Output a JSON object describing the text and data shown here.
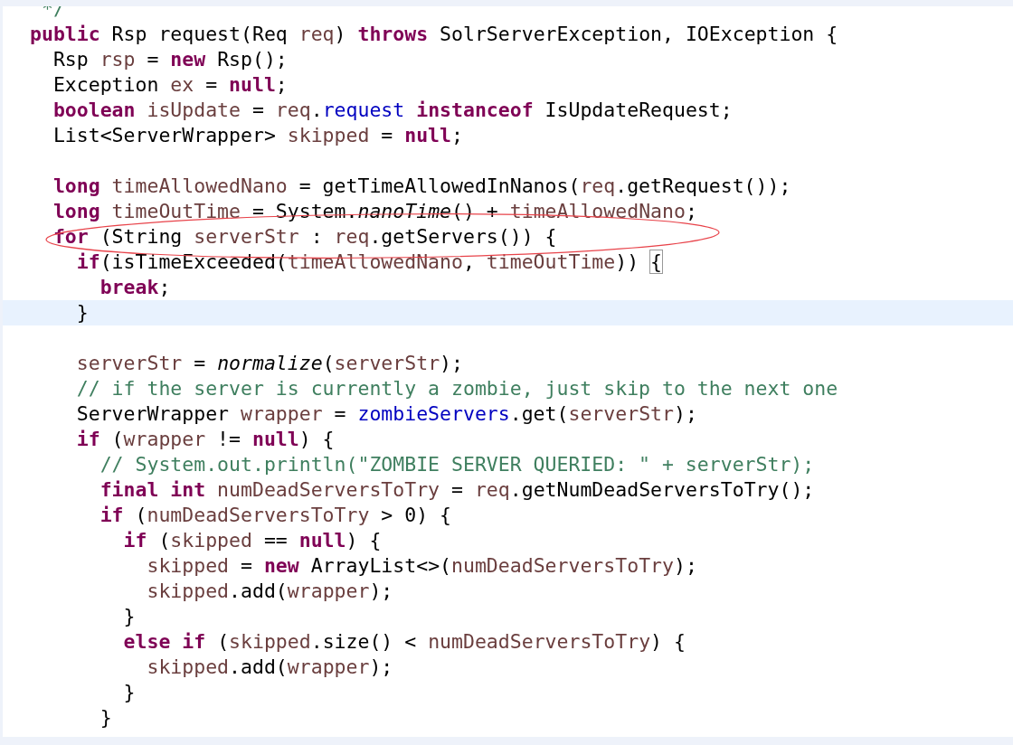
{
  "editor": {
    "lines": [
      {
        "current": false,
        "tokens": [
          {
            "t": " */",
            "kind": "comment"
          }
        ]
      },
      {
        "current": false,
        "tokens": [
          {
            "t": "public",
            "kind": "kw"
          },
          {
            "t": " Rsp request(Req ",
            "kind": "plain"
          },
          {
            "t": "req",
            "kind": "var"
          },
          {
            "t": ") ",
            "kind": "plain"
          },
          {
            "t": "throws",
            "kind": "kw"
          },
          {
            "t": " SolrServerException, IOException {",
            "kind": "plain"
          }
        ]
      },
      {
        "current": false,
        "tokens": [
          {
            "t": "  Rsp ",
            "kind": "plain"
          },
          {
            "t": "rsp",
            "kind": "var"
          },
          {
            "t": " = ",
            "kind": "plain"
          },
          {
            "t": "new",
            "kind": "kw"
          },
          {
            "t": " Rsp();",
            "kind": "plain"
          }
        ]
      },
      {
        "current": false,
        "tokens": [
          {
            "t": "  Exception ",
            "kind": "plain"
          },
          {
            "t": "ex",
            "kind": "var"
          },
          {
            "t": " = ",
            "kind": "plain"
          },
          {
            "t": "null",
            "kind": "kw"
          },
          {
            "t": ";",
            "kind": "plain"
          }
        ]
      },
      {
        "current": false,
        "tokens": [
          {
            "t": "  boolean",
            "kind": "kw"
          },
          {
            "t": " isUpdate",
            "kind": "var"
          },
          {
            "t": " = ",
            "kind": "plain"
          },
          {
            "t": "req",
            "kind": "var"
          },
          {
            "t": ".",
            "kind": "plain"
          },
          {
            "t": "request",
            "kind": "field"
          },
          {
            "t": " instanceof",
            "kind": "kw"
          },
          {
            "t": " IsUpdateRequest;",
            "kind": "plain"
          }
        ]
      },
      {
        "current": false,
        "tokens": [
          {
            "t": "  List<ServerWrapper> ",
            "kind": "plain"
          },
          {
            "t": "skipped",
            "kind": "var"
          },
          {
            "t": " = ",
            "kind": "plain"
          },
          {
            "t": "null",
            "kind": "kw"
          },
          {
            "t": ";",
            "kind": "plain"
          }
        ]
      },
      {
        "current": false
      },
      {
        "current": false,
        "tokens": [
          {
            "t": "  long",
            "kind": "kw"
          },
          {
            "t": " timeAllowedNano",
            "kind": "var"
          },
          {
            "t": " = getTimeAllowedInNanos(",
            "kind": "plain"
          },
          {
            "t": "req",
            "kind": "var"
          },
          {
            "t": ".getRequest());",
            "kind": "plain"
          }
        ]
      },
      {
        "current": false,
        "tokens": [
          {
            "t": "  long",
            "kind": "kw"
          },
          {
            "t": " timeOutTime",
            "kind": "var"
          },
          {
            "t": " = System.",
            "kind": "plain"
          },
          {
            "t": "nanoTime",
            "kind": "static"
          },
          {
            "t": "() + ",
            "kind": "plain"
          },
          {
            "t": "timeAllowedNano",
            "kind": "var"
          },
          {
            "t": ";",
            "kind": "plain"
          }
        ]
      },
      {
        "current": false,
        "tokens": [
          {
            "t": "  for",
            "kind": "kw"
          },
          {
            "t": " (String ",
            "kind": "plain"
          },
          {
            "t": "serverStr",
            "kind": "var"
          },
          {
            "t": " : ",
            "kind": "plain"
          },
          {
            "t": "req",
            "kind": "var"
          },
          {
            "t": ".getServers()) {",
            "kind": "plain"
          }
        ]
      },
      {
        "current": false,
        "tokens": [
          {
            "t": "    if",
            "kind": "kw"
          },
          {
            "t": "(isTimeExceeded(",
            "kind": "plain"
          },
          {
            "t": "timeAllowedNano",
            "kind": "var"
          },
          {
            "t": ", ",
            "kind": "plain"
          },
          {
            "t": "timeOutTime",
            "kind": "var"
          },
          {
            "t": ")) ",
            "kind": "plain"
          },
          {
            "t": "{",
            "kind": "bracket_match"
          }
        ]
      },
      {
        "current": false,
        "tokens": [
          {
            "t": "      break",
            "kind": "kw"
          },
          {
            "t": ";",
            "kind": "plain"
          }
        ]
      },
      {
        "current": true,
        "tokens": [
          {
            "t": "    }",
            "kind": "plain"
          }
        ]
      },
      {
        "current": false
      },
      {
        "current": false,
        "tokens": [
          {
            "t": "    serverStr",
            "kind": "var"
          },
          {
            "t": " = ",
            "kind": "plain"
          },
          {
            "t": "normalize",
            "kind": "static"
          },
          {
            "t": "(",
            "kind": "plain"
          },
          {
            "t": "serverStr",
            "kind": "var"
          },
          {
            "t": ");",
            "kind": "plain"
          }
        ]
      },
      {
        "current": false,
        "tokens": [
          {
            "t": "    // if the server is currently a zombie, just skip to the next one",
            "kind": "comment"
          }
        ]
      },
      {
        "current": false,
        "tokens": [
          {
            "t": "    ServerWrapper ",
            "kind": "plain"
          },
          {
            "t": "wrapper",
            "kind": "var"
          },
          {
            "t": " = ",
            "kind": "plain"
          },
          {
            "t": "zombieServers",
            "kind": "field"
          },
          {
            "t": ".get(",
            "kind": "plain"
          },
          {
            "t": "serverStr",
            "kind": "var"
          },
          {
            "t": ");",
            "kind": "plain"
          }
        ]
      },
      {
        "current": false,
        "tokens": [
          {
            "t": "    if",
            "kind": "kw"
          },
          {
            "t": " (",
            "kind": "plain"
          },
          {
            "t": "wrapper",
            "kind": "var"
          },
          {
            "t": " != ",
            "kind": "plain"
          },
          {
            "t": "null",
            "kind": "kw"
          },
          {
            "t": ") {",
            "kind": "plain"
          }
        ]
      },
      {
        "current": false,
        "tokens": [
          {
            "t": "      // System.out.println(\"ZOMBIE SERVER QUERIED: \" + serverStr);",
            "kind": "comment"
          }
        ]
      },
      {
        "current": false,
        "tokens": [
          {
            "t": "      final",
            "kind": "kw"
          },
          {
            "t": " int",
            "kind": "kw"
          },
          {
            "t": " numDeadServersToTry",
            "kind": "var"
          },
          {
            "t": " = ",
            "kind": "plain"
          },
          {
            "t": "req",
            "kind": "var"
          },
          {
            "t": ".getNumDeadServersToTry();",
            "kind": "plain"
          }
        ]
      },
      {
        "current": false,
        "tokens": [
          {
            "t": "      if",
            "kind": "kw"
          },
          {
            "t": " (",
            "kind": "plain"
          },
          {
            "t": "numDeadServersToTry",
            "kind": "var"
          },
          {
            "t": " > 0) {",
            "kind": "plain"
          }
        ]
      },
      {
        "current": false,
        "tokens": [
          {
            "t": "        if",
            "kind": "kw"
          },
          {
            "t": " (",
            "kind": "plain"
          },
          {
            "t": "skipped",
            "kind": "var"
          },
          {
            "t": " == ",
            "kind": "plain"
          },
          {
            "t": "null",
            "kind": "kw"
          },
          {
            "t": ") {",
            "kind": "plain"
          }
        ]
      },
      {
        "current": false,
        "tokens": [
          {
            "t": "          skipped",
            "kind": "var"
          },
          {
            "t": " = ",
            "kind": "plain"
          },
          {
            "t": "new",
            "kind": "kw"
          },
          {
            "t": " ArrayList<>(",
            "kind": "plain"
          },
          {
            "t": "numDeadServersToTry",
            "kind": "var"
          },
          {
            "t": ");",
            "kind": "plain"
          }
        ]
      },
      {
        "current": false,
        "tokens": [
          {
            "t": "          skipped",
            "kind": "var"
          },
          {
            "t": ".add(",
            "kind": "plain"
          },
          {
            "t": "wrapper",
            "kind": "var"
          },
          {
            "t": ");",
            "kind": "plain"
          }
        ]
      },
      {
        "current": false,
        "tokens": [
          {
            "t": "        }",
            "kind": "plain"
          }
        ]
      },
      {
        "current": false,
        "tokens": [
          {
            "t": "        else",
            "kind": "kw"
          },
          {
            "t": " if",
            "kind": "kw"
          },
          {
            "t": " (",
            "kind": "plain"
          },
          {
            "t": "skipped",
            "kind": "var"
          },
          {
            "t": ".size() < ",
            "kind": "plain"
          },
          {
            "t": "numDeadServersToTry",
            "kind": "var"
          },
          {
            "t": ") {",
            "kind": "plain"
          }
        ]
      },
      {
        "current": false,
        "tokens": [
          {
            "t": "          skipped",
            "kind": "var"
          },
          {
            "t": ".add(",
            "kind": "plain"
          },
          {
            "t": "wrapper",
            "kind": "var"
          },
          {
            "t": ");",
            "kind": "plain"
          }
        ]
      },
      {
        "current": false,
        "tokens": [
          {
            "t": "        }",
            "kind": "plain"
          }
        ]
      },
      {
        "current": false,
        "tokens": [
          {
            "t": "      }",
            "kind": "plain"
          }
        ]
      }
    ]
  }
}
